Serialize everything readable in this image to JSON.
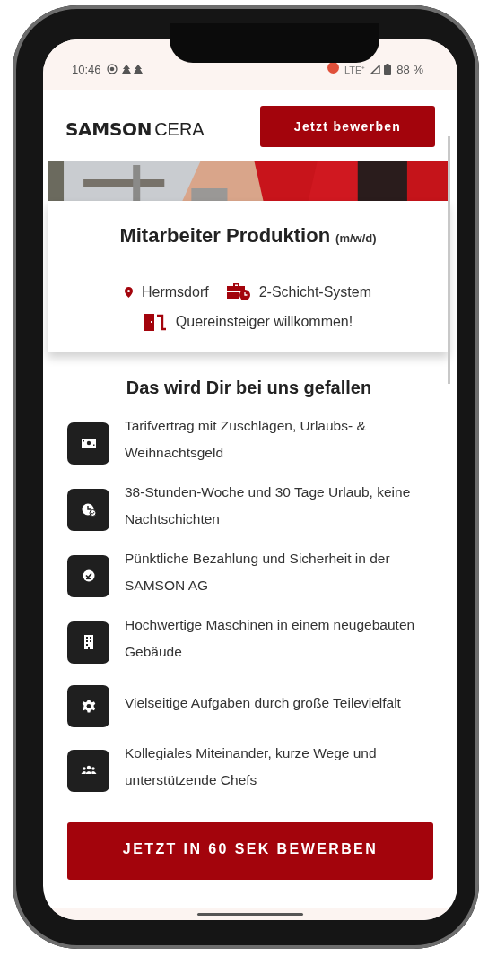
{
  "status_bar": {
    "time": "10:46",
    "network": "LTE⁺",
    "battery": "88 %"
  },
  "header": {
    "logo_bold": "SAMSON",
    "logo_light": "CERA",
    "apply_button": "Jetzt bewerben"
  },
  "job": {
    "title": "Mitarbeiter Produktion",
    "suffix": "(m/w/d)",
    "location": "Hermsdorf",
    "shift": "2-Schicht-System",
    "note": "Quereinsteiger willkommen!"
  },
  "benefits": {
    "heading": "Das wird Dir bei uns gefallen",
    "items": [
      {
        "kind": "money",
        "text": "Tarifvertrag mit Zuschlägen, Urlaubs- & Weihnachtsgeld"
      },
      {
        "kind": "clock",
        "text": "38-Stunden-Woche und 30 Tage Urlaub, keine Nachtschichten"
      },
      {
        "kind": "check",
        "text": "Pünktliche Bezahlung und Sicherheit in der SAMSON AG"
      },
      {
        "kind": "building",
        "text": "Hochwertige Maschinen in einem neugebauten Gebäude"
      },
      {
        "kind": "gear",
        "text": "Vielseitige Aufgaben durch große Teilevielfalt"
      },
      {
        "kind": "team",
        "text": "Kollegiales Miteinander, kurze Wege und unterstützende Chefs"
      }
    ]
  },
  "cta_button": "JETZT IN 60 SEK BEWERBEN"
}
